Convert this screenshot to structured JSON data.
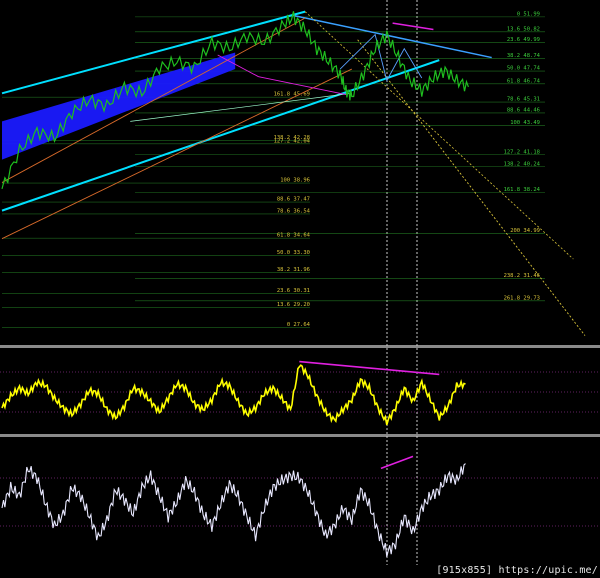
{
  "footer": {
    "size_text": "[915x855]",
    "url_text": "https://upic.me/"
  },
  "colors": {
    "background": "#000000",
    "price": "#1fbf1f",
    "channel_fill": "#1a1aff",
    "cyan_line": "#00e0ff",
    "orange_line": "#d86a2a",
    "magenta": "#e020e0",
    "yellow_osc": "#ffff00",
    "white_osc": "#e8e8ff",
    "divider": "#8a8a8a",
    "fib_text_green": "#3ccf3c",
    "fib_text_yellow": "#d9c43a"
  },
  "chart_data": [
    {
      "type": "line",
      "panel": "price",
      "x_range": [
        0,
        100
      ],
      "ylim": [
        26.5,
        53
      ],
      "fib_right_levels": [
        {
          "ratio": "0",
          "price": 51.99
        },
        {
          "ratio": "13.6",
          "price": 50.82
        },
        {
          "ratio": "23.6",
          "price": 49.99
        },
        {
          "ratio": "38.2",
          "price": 48.74
        },
        {
          "ratio": "50.0",
          "price": 47.74
        },
        {
          "ratio": "61.8",
          "price": 46.74
        },
        {
          "ratio": "78.6",
          "price": 45.31
        },
        {
          "ratio": "88.6",
          "price": 44.46
        },
        {
          "ratio": "100",
          "price": 43.49
        },
        {
          "ratio": "127.2",
          "price": 41.18
        },
        {
          "ratio": "138.2",
          "price": 40.24
        },
        {
          "ratio": "161.8",
          "price": 38.24
        },
        {
          "ratio": "200",
          "price": 34.99
        },
        {
          "ratio": "238.2",
          "price": 31.46
        },
        {
          "ratio": "261.8",
          "price": 29.73
        }
      ],
      "fib_left_levels": [
        {
          "ratio": "161.8",
          "price": 45.69
        },
        {
          "ratio": "138.2",
          "price": 42.28
        },
        {
          "ratio": "127.2",
          "price": 42.04
        },
        {
          "ratio": "100",
          "price": 38.96
        },
        {
          "ratio": "88.6",
          "price": 37.47
        },
        {
          "ratio": "78.6",
          "price": 36.54
        },
        {
          "ratio": "61.8",
          "price": 34.64
        },
        {
          "ratio": "50.0",
          "price": 33.3
        },
        {
          "ratio": "38.2",
          "price": 31.96
        },
        {
          "ratio": "23.6",
          "price": 30.31
        },
        {
          "ratio": "13.6",
          "price": 29.2
        },
        {
          "ratio": "0",
          "price": 27.64
        }
      ],
      "series": [
        {
          "values": [
            [
              0,
              38.5
            ],
            [
              3,
              41.5
            ],
            [
              6,
              43.0
            ],
            [
              9,
              42.5
            ],
            [
              12,
              44.5
            ],
            [
              15,
              45.5
            ],
            [
              18,
              45.0
            ],
            [
              21,
              46.5
            ],
            [
              24,
              46.0
            ],
            [
              27,
              48.0
            ],
            [
              30,
              48.5
            ],
            [
              33,
              48.0
            ],
            [
              36,
              50.0
            ],
            [
              39,
              49.5
            ],
            [
              42,
              50.5
            ],
            [
              45,
              50.0
            ],
            [
              48,
              51.3
            ],
            [
              50,
              52.0
            ],
            [
              52,
              51.0
            ],
            [
              54,
              49.5
            ],
            [
              56,
              48.5
            ],
            [
              58,
              47.5
            ],
            [
              59,
              46.2
            ],
            [
              60,
              45.8
            ],
            [
              62,
              47.5
            ],
            [
              64,
              49.5
            ],
            [
              66,
              50.6
            ],
            [
              68,
              48.8
            ],
            [
              70,
              47.0
            ],
            [
              72,
              46.2
            ],
            [
              74,
              47.2
            ],
            [
              76,
              47.8
            ],
            [
              78,
              47.0
            ],
            [
              80,
              46.5
            ]
          ]
        }
      ]
    },
    {
      "type": "line",
      "panel": "oscillator-yellow",
      "x_range": [
        0,
        100
      ],
      "ylim": [
        0,
        100
      ],
      "series": [
        {
          "values": [
            [
              0,
              30
            ],
            [
              1.5,
              45
            ],
            [
              3,
              55
            ],
            [
              4.5,
              48
            ],
            [
              6,
              62
            ],
            [
              7.5,
              58
            ],
            [
              9,
              42
            ],
            [
              10.5,
              30
            ],
            [
              12,
              22
            ],
            [
              13.5,
              35
            ],
            [
              15,
              52
            ],
            [
              16.5,
              48
            ],
            [
              18,
              28
            ],
            [
              19.5,
              18
            ],
            [
              21,
              32
            ],
            [
              22.5,
              55
            ],
            [
              24,
              50
            ],
            [
              25.5,
              38
            ],
            [
              27,
              25
            ],
            [
              28.5,
              42
            ],
            [
              30,
              60
            ],
            [
              31.5,
              55
            ],
            [
              33,
              35
            ],
            [
              34.5,
              28
            ],
            [
              36,
              40
            ],
            [
              37.5,
              62
            ],
            [
              39,
              58
            ],
            [
              40.5,
              38
            ],
            [
              42,
              22
            ],
            [
              43.5,
              30
            ],
            [
              45,
              48
            ],
            [
              46.5,
              55
            ],
            [
              48,
              42
            ],
            [
              49.5,
              28
            ],
            [
              51,
              85
            ],
            [
              52.5,
              70
            ],
            [
              54,
              45
            ],
            [
              55.5,
              25
            ],
            [
              57,
              15
            ],
            [
              58.5,
              28
            ],
            [
              60,
              40
            ],
            [
              61.5,
              65
            ],
            [
              63,
              55
            ],
            [
              64.5,
              30
            ],
            [
              66,
              12
            ],
            [
              67.5,
              30
            ],
            [
              69,
              55
            ],
            [
              70.5,
              38
            ],
            [
              72,
              62
            ],
            [
              73.5,
              40
            ],
            [
              75,
              18
            ],
            [
              76.5,
              32
            ],
            [
              78,
              58
            ],
            [
              79.5,
              60
            ]
          ]
        }
      ]
    },
    {
      "type": "line",
      "panel": "oscillator-white",
      "x_range": [
        0,
        100
      ],
      "ylim": [
        0,
        100
      ],
      "series": [
        {
          "values": [
            [
              0,
              45
            ],
            [
              1.5,
              62
            ],
            [
              3,
              55
            ],
            [
              4.5,
              78
            ],
            [
              6,
              70
            ],
            [
              7.5,
              48
            ],
            [
              9,
              30
            ],
            [
              10.5,
              40
            ],
            [
              12,
              62
            ],
            [
              13.5,
              55
            ],
            [
              15,
              38
            ],
            [
              16.5,
              20
            ],
            [
              18,
              35
            ],
            [
              19.5,
              60
            ],
            [
              21,
              52
            ],
            [
              22.5,
              40
            ],
            [
              24,
              62
            ],
            [
              25.5,
              72
            ],
            [
              27,
              55
            ],
            [
              28.5,
              38
            ],
            [
              30,
              50
            ],
            [
              31.5,
              68
            ],
            [
              33,
              58
            ],
            [
              34.5,
              40
            ],
            [
              36,
              30
            ],
            [
              37.5,
              48
            ],
            [
              39,
              65
            ],
            [
              40.5,
              55
            ],
            [
              42,
              38
            ],
            [
              43.5,
              22
            ],
            [
              45,
              45
            ],
            [
              46.5,
              62
            ],
            [
              48,
              68
            ],
            [
              49.5,
              72
            ],
            [
              51,
              70
            ],
            [
              52.5,
              58
            ],
            [
              54,
              40
            ],
            [
              55.5,
              22
            ],
            [
              57,
              30
            ],
            [
              58.5,
              45
            ],
            [
              60,
              35
            ],
            [
              61.5,
              60
            ],
            [
              63,
              48
            ],
            [
              64.5,
              25
            ],
            [
              66,
              8
            ],
            [
              67.5,
              15
            ],
            [
              69,
              38
            ],
            [
              70.5,
              25
            ],
            [
              72,
              45
            ],
            [
              73.5,
              55
            ],
            [
              75,
              60
            ],
            [
              76.5,
              72
            ],
            [
              78,
              68
            ],
            [
              79.5,
              82
            ]
          ]
        }
      ]
    }
  ]
}
